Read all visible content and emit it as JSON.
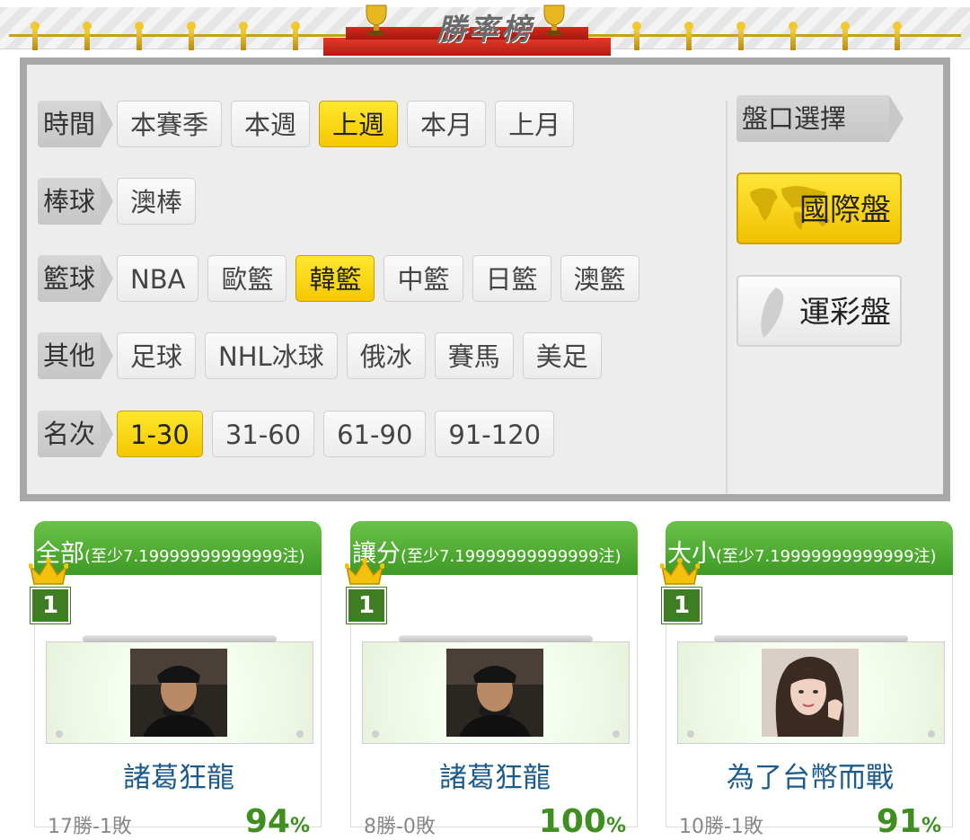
{
  "banner": {
    "title": "勝率榜"
  },
  "filters": {
    "time": {
      "label": "時間",
      "options": [
        "本賽季",
        "本週",
        "上週",
        "本月",
        "上月"
      ],
      "selected": "上週"
    },
    "baseball": {
      "label": "棒球",
      "options": [
        "澳棒"
      ]
    },
    "basketball": {
      "label": "籃球",
      "options": [
        "NBA",
        "歐籃",
        "韓籃",
        "中籃",
        "日籃",
        "澳籃"
      ],
      "selected": "韓籃"
    },
    "other": {
      "label": "其他",
      "options": [
        "足球",
        "NHL冰球",
        "俄冰",
        "賽馬",
        "美足"
      ]
    },
    "rank": {
      "label": "名次",
      "options": [
        "1-30",
        "31-60",
        "61-90",
        "91-120"
      ],
      "selected": "1-30"
    }
  },
  "odds": {
    "label": "盤口選擇",
    "international": "國際盤",
    "sports_lottery": "運彩盤",
    "selected": "國際盤"
  },
  "cards": [
    {
      "category": "全部",
      "note": "(至少7.19999999999999注)",
      "rank": "1",
      "name": "諸葛狂龍",
      "record": "17勝-1敗",
      "rate": "94",
      "pct": "%"
    },
    {
      "category": "讓分",
      "note": "(至少7.19999999999999注)",
      "rank": "1",
      "name": "諸葛狂龍",
      "record": "8勝-0敗",
      "rate": "100",
      "pct": "%"
    },
    {
      "category": "大小",
      "note": "(至少7.19999999999999注)",
      "rank": "1",
      "name": "為了台幣而戰",
      "record": "10勝-1敗",
      "rate": "91",
      "pct": "%"
    }
  ],
  "colors": {
    "selected": "#f4c800",
    "header_green": "#3d9a23",
    "name_blue": "#1c5b8a",
    "rate_green": "#3e8f1f"
  }
}
